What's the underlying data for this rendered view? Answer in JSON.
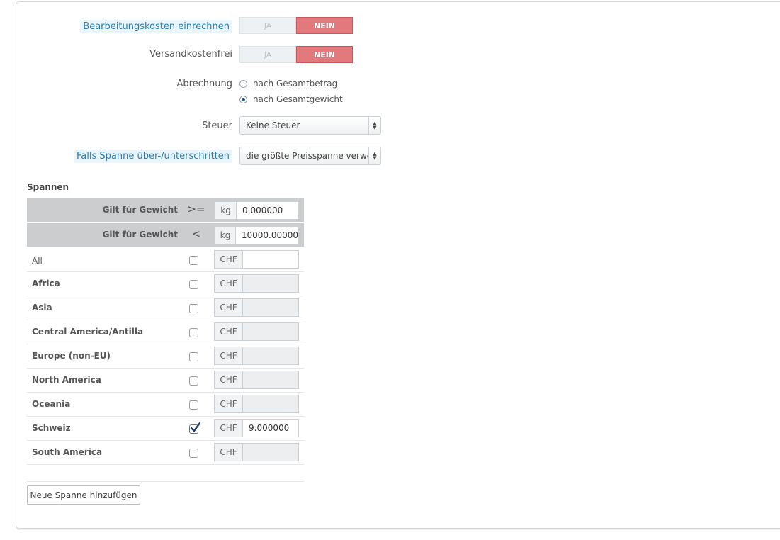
{
  "settings": {
    "handling_label": "Bearbeitungskosten einrechnen",
    "free_shipping_label": "Versandkostenfrei",
    "switch_yes": "JA",
    "switch_no": "NEIN",
    "billing_label": "Abrechnung",
    "billing_options": [
      "nach Gesamtbetrag",
      "nach Gesamtgewicht"
    ],
    "billing_selected": 1,
    "tax_label": "Steuer",
    "tax_value": "Keine Steuer",
    "out_of_range_label": "Falls Spanne über-/unterschritten",
    "out_of_range_value": "die größte Preisspanne verwei"
  },
  "ranges": {
    "title": "Spannen",
    "rows": [
      {
        "label": "Gilt für Gewicht",
        "operator": ">=",
        "unit": "kg",
        "value": "0.000000"
      },
      {
        "label": "Gilt für Gewicht",
        "operator": "<",
        "unit": "kg",
        "value": "10000.00000"
      }
    ],
    "currency": "CHF",
    "zones": [
      {
        "name": "All",
        "checked": false,
        "value": "",
        "enabled": true
      },
      {
        "name": "Africa",
        "checked": false,
        "value": "",
        "enabled": false
      },
      {
        "name": "Asia",
        "checked": false,
        "value": "",
        "enabled": false
      },
      {
        "name": "Central America/Antilla",
        "checked": false,
        "value": "",
        "enabled": false
      },
      {
        "name": "Europe (non-EU)",
        "checked": false,
        "value": "",
        "enabled": false
      },
      {
        "name": "North America",
        "checked": false,
        "value": "",
        "enabled": false
      },
      {
        "name": "Oceania",
        "checked": false,
        "value": "",
        "enabled": false
      },
      {
        "name": "Schweiz",
        "checked": true,
        "value": "9.000000",
        "enabled": true
      },
      {
        "name": "South America",
        "checked": false,
        "value": "",
        "enabled": false
      }
    ],
    "add_button": "Neue Spanne hinzufügen"
  },
  "colors": {
    "accent_no": "#e2797d",
    "hint_text": "#2a7eb0",
    "hint_bg": "#e9f5fb"
  }
}
